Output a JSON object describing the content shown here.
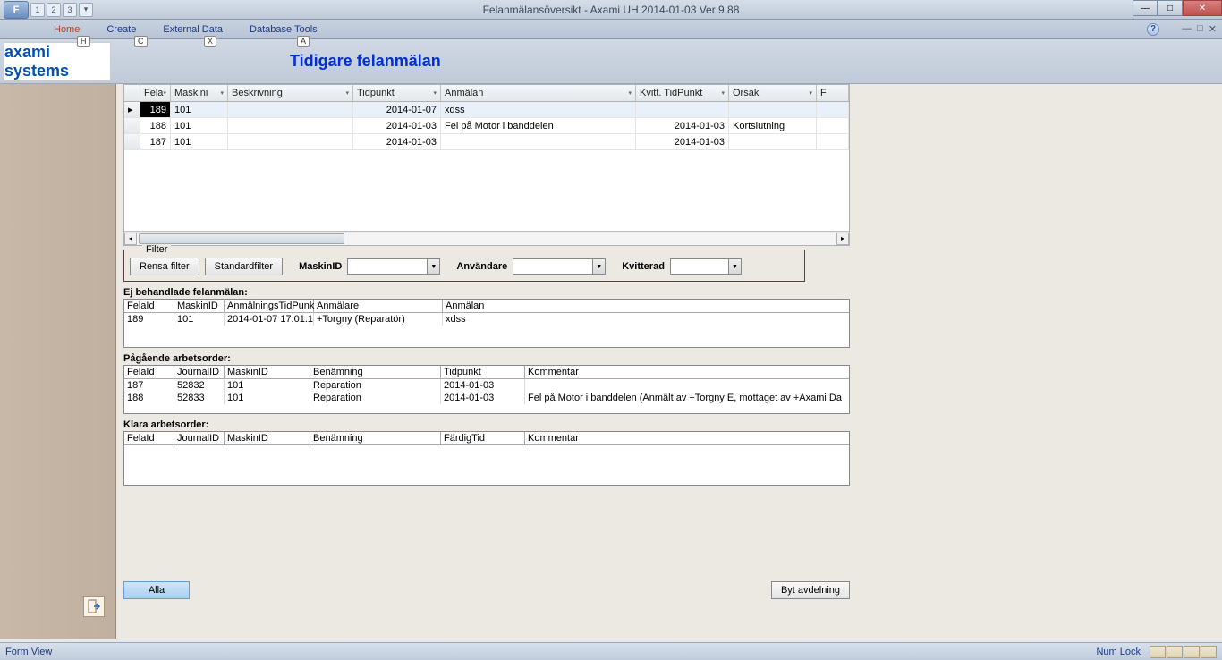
{
  "window": {
    "title": "Felanmälansöversikt - Axami UH 2014-01-03 Ver 9.88",
    "qat": [
      "1",
      "2",
      "3"
    ]
  },
  "ribbon": {
    "tabs": {
      "home": "Home",
      "create": "Create",
      "external": "External Data",
      "dbtools": "Database Tools"
    },
    "keytips": {
      "f": "F",
      "h": "H",
      "c": "C",
      "x": "X",
      "a": "A"
    }
  },
  "header": {
    "logo": "axami",
    "logo_sub": "systems",
    "title": "Tidigare felanmälan"
  },
  "grid": {
    "cols": {
      "fel": "Fela",
      "mask": "Maskini",
      "besk": "Beskrivning",
      "tid": "Tidpunkt",
      "anm": "Anmälan",
      "kvitt": "Kvitt. TidPunkt",
      "orsak": "Orsak",
      "last": "F"
    },
    "rows": [
      {
        "fel": "189",
        "mask": "101",
        "besk": "",
        "tid": "2014-01-07",
        "anm": "xdss",
        "kvitt": "",
        "orsak": ""
      },
      {
        "fel": "188",
        "mask": "101",
        "besk": "",
        "tid": "2014-01-03",
        "anm": "Fel på Motor i banddelen",
        "kvitt": "2014-01-03",
        "orsak": "Kortslutning"
      },
      {
        "fel": "187",
        "mask": "101",
        "besk": "",
        "tid": "2014-01-03",
        "anm": "",
        "kvitt": "2014-01-03",
        "orsak": ""
      }
    ]
  },
  "filter": {
    "legend": "Filter",
    "rensa": "Rensa filter",
    "standard": "Standardfilter",
    "maskin": "MaskinID",
    "anvand": "Användare",
    "kvitt": "Kvitterad"
  },
  "sec1": {
    "title": "Ej behandlade felanmälan:",
    "cols": {
      "fel": "FelaId",
      "mask": "MaskinID",
      "tid": "AnmälningsTidPunk",
      "anmalare": "Anmälare",
      "anmalan": "Anmälan"
    },
    "rows": [
      {
        "fel": "189",
        "mask": "101",
        "tid": "2014-01-07 17:01:1",
        "anmalare": " +Torgny     (Reparatör)",
        "anmalan": "xdss"
      }
    ]
  },
  "sec2": {
    "title": "Pågående arbetsorder:",
    "cols": {
      "fel": "FelaId",
      "journal": "JournalID",
      "mask": "MaskinID",
      "benamn": "Benämning",
      "tid": "Tidpunkt",
      "komm": "Kommentar"
    },
    "rows": [
      {
        "fel": "187",
        "journal": "52832",
        "mask": "101",
        "benamn": "Reparation",
        "tid": "2014-01-03",
        "komm": ""
      },
      {
        "fel": "188",
        "journal": "52833",
        "mask": "101",
        "benamn": "Reparation",
        "tid": "2014-01-03",
        "komm": "Fel på Motor i banddelen (Anmält av   +Torgny     E, mottaget av   +Axami Da"
      }
    ]
  },
  "sec3": {
    "title": "Klara arbetsorder:",
    "cols": {
      "fel": "FelaId",
      "journal": "JournalID",
      "mask": "MaskinID",
      "benamn": "Benämning",
      "fardig": "FärdigTid",
      "komm": "Kommentar"
    }
  },
  "buttons": {
    "alla": "Alla",
    "byt": "Byt avdelning"
  },
  "status": {
    "left": "Form View",
    "right": "Num Lock"
  }
}
